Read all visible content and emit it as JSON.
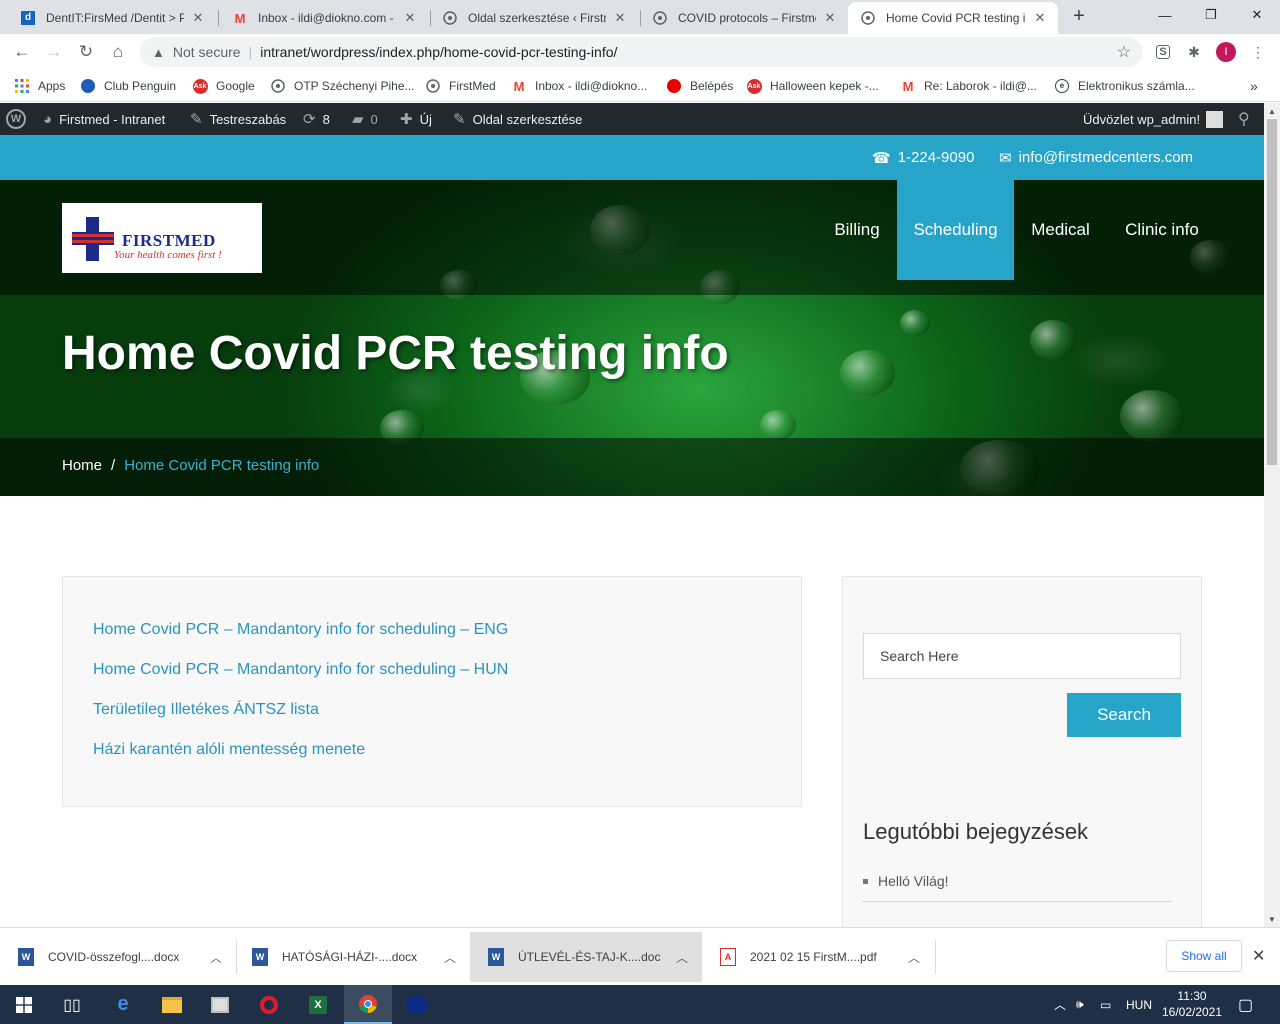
{
  "browser": {
    "tabs": [
      {
        "title": "DentIT:FirsMed /Dentit > PC",
        "favicon": "dentit-icon",
        "active": false
      },
      {
        "title": "Inbox - ildi@diokno.com - D",
        "favicon": "gmail-icon",
        "active": false
      },
      {
        "title": "Oldal szerkesztése ‹ Firstme",
        "favicon": "globe-icon",
        "active": false
      },
      {
        "title": "COVID protocols – Firstmed",
        "favicon": "globe-icon",
        "active": false
      },
      {
        "title": "Home Covid PCR testing inf",
        "favicon": "globe-icon",
        "active": true
      }
    ],
    "new_tab": "+",
    "window_controls": {
      "minimize": "—",
      "maximize": "❐",
      "close": "✕"
    },
    "address": {
      "security": "Not secure",
      "url": "intranet/wordpress/index.php/home-covid-pcr-testing-info/"
    },
    "profile_initial": "I",
    "bookmarks": [
      {
        "label": "Apps",
        "icon": "apps-grid-icon"
      },
      {
        "label": "Club Penguin",
        "icon": "penguin-icon"
      },
      {
        "label": "Google",
        "icon": "ask-icon"
      },
      {
        "label": "OTP Széchenyi Pihe...",
        "icon": "globe-icon"
      },
      {
        "label": "FirstMed",
        "icon": "globe-icon"
      },
      {
        "label": "Inbox - ildi@diokno...",
        "icon": "gmail-icon"
      },
      {
        "label": "Belépés",
        "icon": "vodafone-icon"
      },
      {
        "label": "Halloween kepek -...",
        "icon": "ask-icon"
      },
      {
        "label": "Re: Laborok - ildi@...",
        "icon": "gmail-icon"
      },
      {
        "label": "Elektronikus számla...",
        "icon": "e-icon"
      }
    ],
    "bookmarks_more": "»"
  },
  "adminbar": {
    "site_name": "Firstmed - Intranet",
    "customize": "Testreszabás",
    "updates_count": "8",
    "comments_count": "0",
    "new_label": "Új",
    "edit_page": "Oldal szerkesztése",
    "greeting": "Üdvözlet wp_admin!"
  },
  "site": {
    "phone": "1-224-9090",
    "email": "info@firstmedcenters.com",
    "logo": {
      "brand": "FIRSTMED",
      "tagline": "Your health comes first !"
    },
    "nav": [
      {
        "label": "Billing",
        "active": false
      },
      {
        "label": "Scheduling",
        "active": true
      },
      {
        "label": "Medical",
        "active": false
      },
      {
        "label": "Clinic info",
        "active": false
      }
    ],
    "page_title": "Home Covid PCR testing info",
    "breadcrumb": {
      "home": "Home",
      "separator": "/",
      "current": "Home Covid PCR testing info"
    },
    "links": [
      "Home Covid PCR – Mandantory info for scheduling  – ENG",
      "Home Covid PCR – Mandantory info for scheduling – HUN",
      "Területileg Illetékes ÁNTSZ lista",
      "Házi karantén alóli mentesség menete"
    ],
    "sidebar": {
      "search_placeholder": "Search Here",
      "search_button": "Search",
      "recent_title": "Legutóbbi bejegyzések",
      "recent_posts": [
        "Helló Világ!"
      ]
    },
    "colors": {
      "accent": "#27a5c9",
      "link": "#2a93c0"
    }
  },
  "downloads": {
    "items": [
      {
        "name": "COVID-összefogl....docx",
        "type": "docx"
      },
      {
        "name": "HATÓSÁGI-HÁZI-....docx",
        "type": "docx"
      },
      {
        "name": "ÚTLEVÉL-ÉS-TAJ-K....doc",
        "type": "doc"
      },
      {
        "name": "2021 02 15 FirstM....pdf",
        "type": "pdf"
      }
    ],
    "show_all": "Show all"
  },
  "taskbar": {
    "language": "HUN",
    "time": "11:30",
    "date": "16/02/2021"
  }
}
